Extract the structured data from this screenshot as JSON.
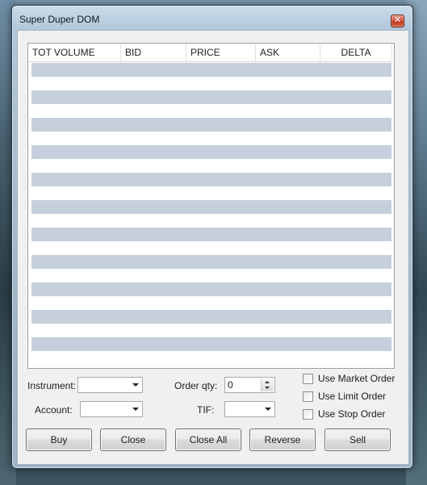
{
  "window": {
    "title": "Super Duper DOM"
  },
  "grid": {
    "columns": [
      "TOT VOLUME",
      "BID",
      "PRICE",
      "ASK",
      "DELTA"
    ],
    "row_count": 11
  },
  "form": {
    "instrument_label": "Instrument:",
    "instrument_value": "",
    "account_label": "Account:",
    "account_value": "",
    "order_qty_label": "Order qty:",
    "order_qty_value": "0",
    "tif_label": "TIF:",
    "tif_value": "",
    "checkboxes": [
      {
        "label": "Use Market Order",
        "checked": false
      },
      {
        "label": "Use Limit Order",
        "checked": false
      },
      {
        "label": "Use Stop Order",
        "checked": false
      }
    ]
  },
  "buttons": [
    "Buy",
    "Close",
    "Close All",
    "Reverse",
    "Sell"
  ],
  "colors": {
    "row_stripe": "#c5d0dc",
    "client_bg": "#f0f0f0",
    "close_button": "#c7402a"
  }
}
